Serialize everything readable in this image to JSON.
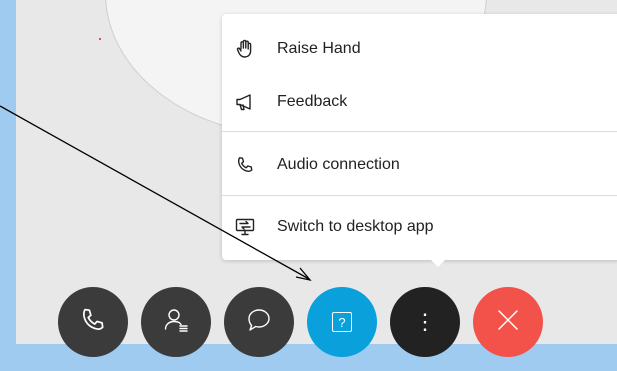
{
  "menu": {
    "items": [
      {
        "label": "Raise Hand",
        "icon": "hand-icon"
      },
      {
        "label": "Feedback",
        "icon": "megaphone-icon"
      },
      {
        "label": "Audio connection",
        "icon": "phone-icon"
      },
      {
        "label": "Switch to desktop app",
        "icon": "desktop-app-icon"
      }
    ]
  },
  "controls": {
    "buttons": [
      {
        "name": "audio-button",
        "icon": "phone-icon",
        "color": "#3b3b3b"
      },
      {
        "name": "participants-button",
        "icon": "participants-icon",
        "color": "#3b3b3b"
      },
      {
        "name": "chat-button",
        "icon": "chat-bubble-icon",
        "color": "#3b3b3b"
      },
      {
        "name": "help-button",
        "icon": "question-icon",
        "color": "#0aa0db",
        "label": "?"
      },
      {
        "name": "more-options-button",
        "icon": "more-vertical-icon",
        "color": "#222222",
        "label": "⋮"
      },
      {
        "name": "leave-button",
        "icon": "close-icon",
        "color": "#f2524a"
      }
    ]
  },
  "colors": {
    "background": "#9ecbef",
    "stage": "#e8e8e8",
    "accent_blue": "#0aa0db",
    "leave_red": "#f2524a"
  }
}
